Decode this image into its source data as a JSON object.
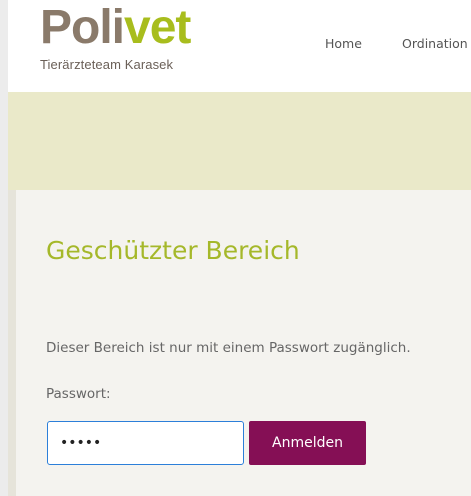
{
  "header": {
    "logo": {
      "name_part1": "Poli",
      "name_part2": "vet",
      "tagline": "Tierärzteteam Karasek"
    },
    "nav": {
      "home": "Home",
      "ordination": "Ordination"
    }
  },
  "main": {
    "title": "Geschützter Bereich",
    "notice": "Dieser Bereich ist nur mit einem Passwort zugänglich.",
    "password_label": "Passwort:",
    "password_value": "•••••",
    "submit_label": "Anmelden"
  },
  "colors": {
    "accent_green": "#a5b82a",
    "logo_brown": "#8a7a6a",
    "button_purple": "#850f55",
    "banner_bg": "#eae9c9",
    "content_bg": "#f4f3ef"
  }
}
